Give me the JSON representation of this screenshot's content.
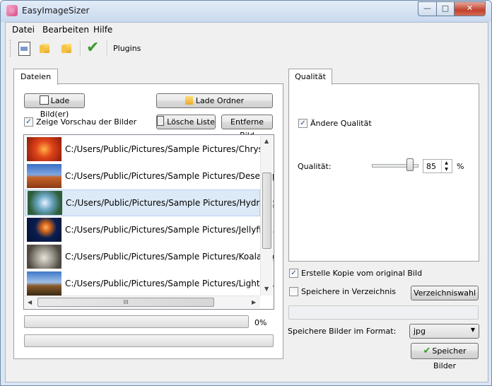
{
  "window": {
    "title": "EasyImageSizer",
    "min_label": "—",
    "max_label": "□",
    "close_label": "✕"
  },
  "menu": {
    "items": [
      "Datei",
      "Bearbeiten",
      "Hilfe"
    ]
  },
  "toolbar": {
    "plugins_label": "Plugins"
  },
  "left_tab": {
    "label": "Dateien"
  },
  "buttons": {
    "load_images": "Lade Bild(er)",
    "load_folder": "Lade Ordner",
    "clear_list": "Lösche Liste",
    "remove_image": "Entferne Bild",
    "directory_choice": "Verzeichniswahl",
    "save_images": "Speicher Bilder"
  },
  "preview_checkbox": {
    "label": "Zeige Vorschau der Bilder",
    "checked": true
  },
  "file_list": {
    "items": [
      {
        "path": "C:/Users/Public/Pictures/Sample Pictures/Chrysanth",
        "thumb": "flower-icon"
      },
      {
        "path": "C:/Users/Public/Pictures/Sample Pictures/Desert.jpg",
        "thumb": "desert-icon"
      },
      {
        "path": "C:/Users/Public/Pictures/Sample Pictures/Hydrange",
        "thumb": "hydrangea-icon"
      },
      {
        "path": "C:/Users/Public/Pictures/Sample Pictures/Jellyfish.jpg",
        "thumb": "jellyfish-icon"
      },
      {
        "path": "C:/Users/Public/Pictures/Sample Pictures/Koala.jpg",
        "thumb": "koala-icon"
      },
      {
        "path": "C:/Users/Public/Pictures/Sample Pictures/Lighthous",
        "thumb": "lighthouse-icon"
      }
    ],
    "selected_index": 2,
    "hscroll_grip": "III"
  },
  "progress": {
    "main_percent_label": "0%",
    "main_value": 0,
    "secondary_value": 0
  },
  "right_tab": {
    "label": "Qualität"
  },
  "quality": {
    "change_label": "Ändere Qualität",
    "change_checked": true,
    "quality_label": "Qualität:",
    "value": "85",
    "unit": "%",
    "slider_fraction": 0.85
  },
  "copy_checkbox": {
    "label": "Erstelle Kopie vom original Bild",
    "checked": true
  },
  "save_dir_checkbox": {
    "label": "Speichere in Verzeichnis",
    "checked": false
  },
  "format": {
    "label": "Speichere Bilder im Format:",
    "value": "jpg"
  },
  "colors": {
    "accent": "#3a9a2a",
    "selection": "#dce9f7"
  }
}
